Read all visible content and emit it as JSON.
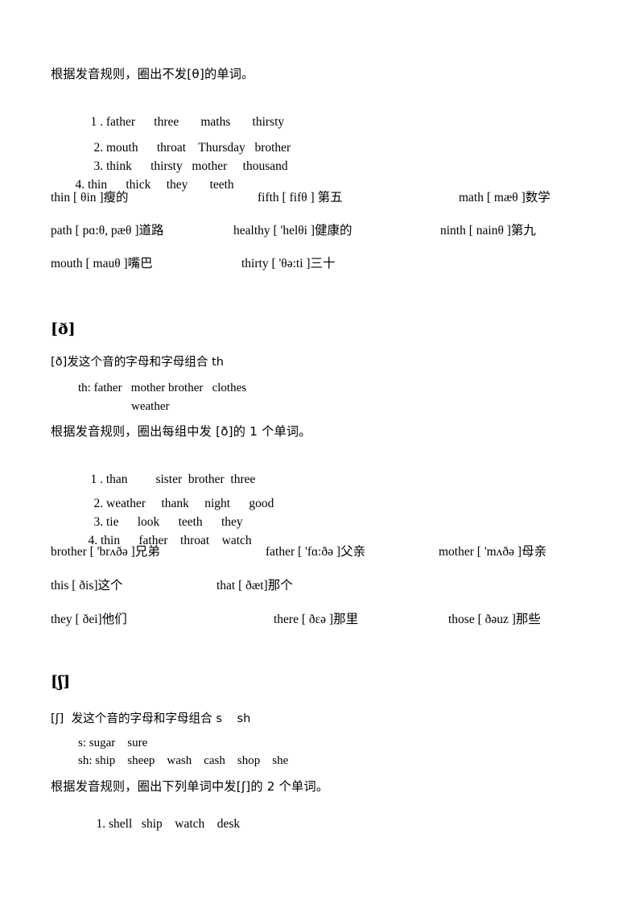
{
  "sections": [
    {
      "id": "theta-exercise",
      "instruction": "根据发音规则，圈出不发[θ]的单词。",
      "word_groups": [
        {
          "number": "1 .",
          "words": [
            "father",
            "three",
            "maths",
            "thirsty"
          ]
        },
        {
          "number": "2.",
          "words": [
            "mouth",
            "throat",
            "Thursday",
            "brother"
          ]
        },
        {
          "number": "3.",
          "words": [
            "think",
            "thirsty",
            "mother",
            "thousand"
          ]
        },
        {
          "number": "4.",
          "words": [
            "thin",
            "thick",
            "they",
            "teeth"
          ]
        }
      ],
      "vocabulary": [
        [
          {
            "word": "thin",
            "ipa": "[ θin ]",
            "gloss": "瘦的"
          },
          {
            "word": "fifth",
            "ipa": "[ fifθ ]",
            "gloss": "第五"
          },
          {
            "word": "math",
            "ipa": "[ mæθ ]",
            "gloss": "数学"
          }
        ],
        [
          {
            "word": "path",
            "ipa": "[ pɑ:θ, pæθ ]",
            "gloss": "道路"
          },
          {
            "word": "healthy",
            "ipa": "[ 'helθi ]",
            "gloss": "健康的"
          },
          {
            "word": "ninth",
            "ipa": "[ nainθ ]",
            "gloss": "第九"
          }
        ],
        [
          {
            "word": "mouth",
            "ipa": "[ mauθ ]",
            "gloss": "嘴巴"
          },
          {
            "word": "thirty",
            "ipa": "[ 'θə:ti ]",
            "gloss": "三十"
          }
        ]
      ]
    },
    {
      "id": "eth",
      "heading": "[ð]",
      "rule_line": "[ð]发这个音的字母和字母组合 th",
      "examples": [
        "th: father    mother brother    clothes",
        "weather"
      ],
      "instruction": "根据发音规则，圈出每组中发 [ð]的 1 个单词。",
      "word_groups": [
        {
          "number": "1 .",
          "words": [
            "than",
            "sister",
            "brother",
            "three"
          ]
        },
        {
          "number": "2.",
          "words": [
            "weather",
            "thank",
            "night",
            "good"
          ]
        },
        {
          "number": "3.",
          "words": [
            "tie",
            "look",
            "teeth",
            "they"
          ]
        },
        {
          "number": "4.",
          "words": [
            "thin",
            "father",
            "throat",
            "watch"
          ]
        }
      ],
      "vocabulary": [
        [
          {
            "word": "brother",
            "ipa": "[ 'brʌðə ]",
            "gloss": "兄弟"
          },
          {
            "word": "father",
            "ipa": "[ 'fɑ:ðə ]",
            "gloss": "父亲"
          },
          {
            "word": "mother",
            "ipa": "[ 'mʌðə ]",
            "gloss": "母亲"
          }
        ],
        [
          {
            "word": "this",
            "ipa": "[ ðis]",
            "gloss": "这个"
          },
          {
            "word": "that",
            "ipa": "[ ðæt]",
            "gloss": "那个"
          }
        ],
        [
          {
            "word": "they",
            "ipa": "[ ðei]",
            "gloss": "他们"
          },
          {
            "word": "there",
            "ipa": "[ ðɛə ]",
            "gloss": "那里"
          },
          {
            "word": "those",
            "ipa": "[ ðəuz ]",
            "gloss": "那些"
          }
        ]
      ]
    },
    {
      "id": "esh",
      "heading": "[ʃ]",
      "rule_line": "[ʃ]  发这个音的字母和字母组合 s    sh",
      "examples": [
        "s: sugar    sure",
        "sh: ship    sheep    wash    cash    shop    she"
      ],
      "instruction": "根据发音规则，圈出下列单词中发[ʃ]的 2 个单词。",
      "word_groups": [
        {
          "number": "1.",
          "words": [
            "shell",
            "ship",
            "watch",
            "desk"
          ]
        }
      ]
    }
  ],
  "text": {
    "s1_instruction": "根据发音规则，圈出不发[θ]的单词。",
    "s1_g1_num": "1 .",
    "s1_g1_w1": "father",
    "s1_g1_w2": "three",
    "s1_g1_w3": "maths",
    "s1_g1_w4": "thirsty",
    "s1_g2_num": "2.",
    "s1_g2_w1": "mouth",
    "s1_g2_w2": "throat",
    "s1_g2_w3": "Thursday",
    "s1_g2_w4": "brother",
    "s1_g3_num": "3.",
    "s1_g3_w1": "think",
    "s1_g3_w2": "thirsty",
    "s1_g3_w3": "mother",
    "s1_g3_w4": "thousand",
    "s1_g4_num": "4.",
    "s1_g4_w1": "thin",
    "s1_g4_w2": "thick",
    "s1_g4_w3": "they",
    "s1_g4_w4": "teeth",
    "v_thin": "thin [ θin ]瘦的",
    "v_fifth": "fifth [ fifθ ] 第五",
    "v_math": "math [ mæθ ]数学",
    "v_path": "path [ pɑ:θ, pæθ ]道路",
    "v_healthy": "healthy [ 'helθi ]健康的",
    "v_ninth": "ninth [ nainθ ]第九",
    "v_mouth": "mouth [ mauθ ]嘴巴",
    "v_thirty": "thirty [ 'θə:ti ]三十",
    "s2_heading": "[ð]",
    "s2_rule": "[ð]发这个音的字母和字母组合 th",
    "s2_ex1": "th: father   mother brother   clothes",
    "s2_ex2": "weather",
    "s2_instruction": "根据发音规则，圈出每组中发 [ð]的 1 个单词。",
    "s2_g1_num": "1 .",
    "s2_g1_w1": "than",
    "s2_g1_w2": "sister",
    "s2_g1_w3": "brother",
    "s2_g1_w4": "three",
    "s2_g2_num": "2.",
    "s2_g2_w1": "weather",
    "s2_g2_w2": "thank",
    "s2_g2_w3": "night",
    "s2_g2_w4": "good",
    "s2_g3_num": "3.",
    "s2_g3_w1": "tie",
    "s2_g3_w2": "look",
    "s2_g3_w3": "teeth",
    "s2_g3_w4": "they",
    "s2_g4_num": "4.",
    "s2_g4_w1": "thin",
    "s2_g4_w2": "father",
    "s2_g4_w3": "throat",
    "s2_g4_w4": "watch",
    "v_brother": "brother [ 'brʌðə ]兄弟",
    "v_father": "father [ 'fɑ:ðə ]父亲",
    "v_mother": "mother [ 'mʌðə ]母亲",
    "v_this": "this [ ðis]这个",
    "v_that": "that [ ðæt]那个",
    "v_they": "they [ ðei]他们",
    "v_there": "there [ ðɛə ]那里",
    "v_those": "those [ ðəuz ]那些",
    "s3_heading": "[ʃ]",
    "s3_rule": "[ʃ]  发这个音的字母和字母组合 s    sh",
    "s3_ex1": "s: sugar    sure",
    "s3_ex2": "sh: ship    sheep    wash    cash    shop    she",
    "s3_instruction": "根据发音规则，圈出下列单词中发[ʃ]的 2 个单词。",
    "s3_g1_num": "1.",
    "s3_g1_w1": "shell",
    "s3_g1_w2": "ship",
    "s3_g1_w3": "watch",
    "s3_g1_w4": "desk"
  }
}
